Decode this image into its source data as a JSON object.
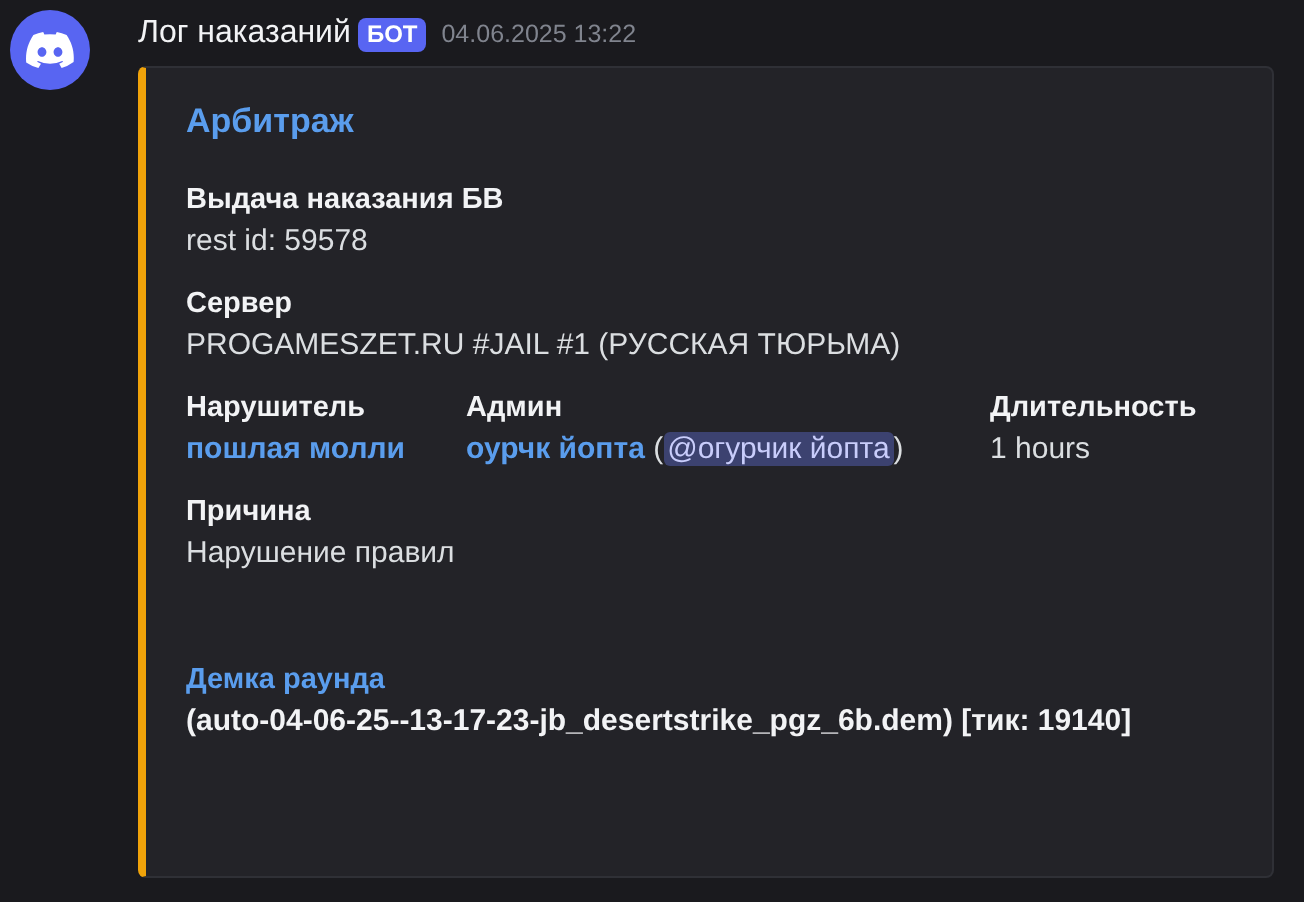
{
  "message": {
    "author": "Лог наказаний",
    "badge": "БОТ",
    "timestamp": "04.06.2025 13:22",
    "embed": {
      "title": "Арбитраж",
      "fields": [
        {
          "kind": "block",
          "name": "Выдача наказания БВ",
          "value": [
            {
              "kind": "text",
              "text": "rest id: 59578"
            }
          ]
        },
        {
          "kind": "block",
          "name": "Сервер",
          "value": [
            {
              "kind": "text",
              "text": "PROGAMESZET.RU #JAIL #1 (РУССКАЯ ТЮРЬМА)"
            }
          ]
        },
        {
          "kind": "inline",
          "name": "Нарушитель",
          "value": [
            {
              "kind": "link",
              "text": "пошлая молли"
            }
          ]
        },
        {
          "kind": "inline",
          "name": "Админ",
          "value": [
            {
              "kind": "link",
              "text": "оурчк йопта"
            },
            {
              "kind": "text",
              "text": " ("
            },
            {
              "kind": "mention",
              "text": "@огурчик йопта"
            },
            {
              "kind": "text",
              "text": ")"
            }
          ]
        },
        {
          "kind": "inline",
          "name": "Длительность",
          "value": [
            {
              "kind": "text",
              "text": "1 hours"
            }
          ]
        },
        {
          "kind": "block",
          "name": "Причина",
          "value": [
            {
              "kind": "text",
              "text": "Нарушение правил"
            }
          ]
        },
        {
          "kind": "linked",
          "name": "Демка раунда",
          "value": [
            {
              "kind": "bold",
              "text": "(auto-04-06-25--13-17-23-jb_desertstrike_pgz_6b.dem) [тик: 19140]"
            }
          ]
        }
      ]
    }
  }
}
